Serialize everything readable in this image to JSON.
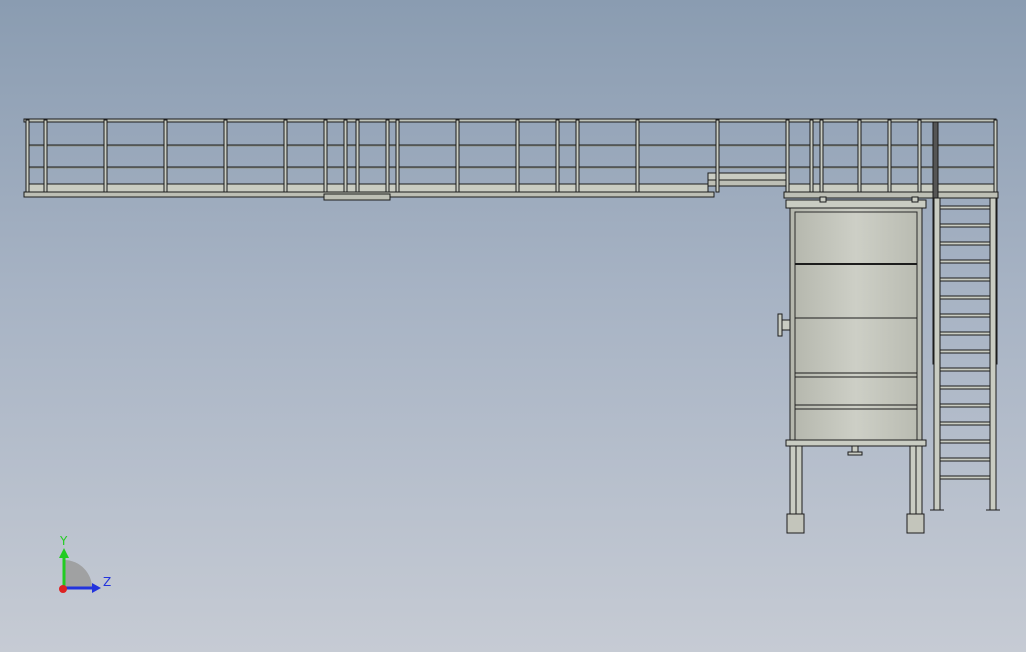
{
  "viewport": {
    "background_top": "#8a9cb1",
    "background_bottom": "#c6cbd4"
  },
  "model": {
    "line_color": "#1c1c1c",
    "metal_fill": "#c9ccc2",
    "tank_fill": "#c5c6bc",
    "rail_fill": "#bfc3b8"
  },
  "triad": {
    "y_label": "Y",
    "z_label": "Z",
    "y_color": "#22cc22",
    "z_color": "#2233dd",
    "x_color": "#dd2222"
  }
}
